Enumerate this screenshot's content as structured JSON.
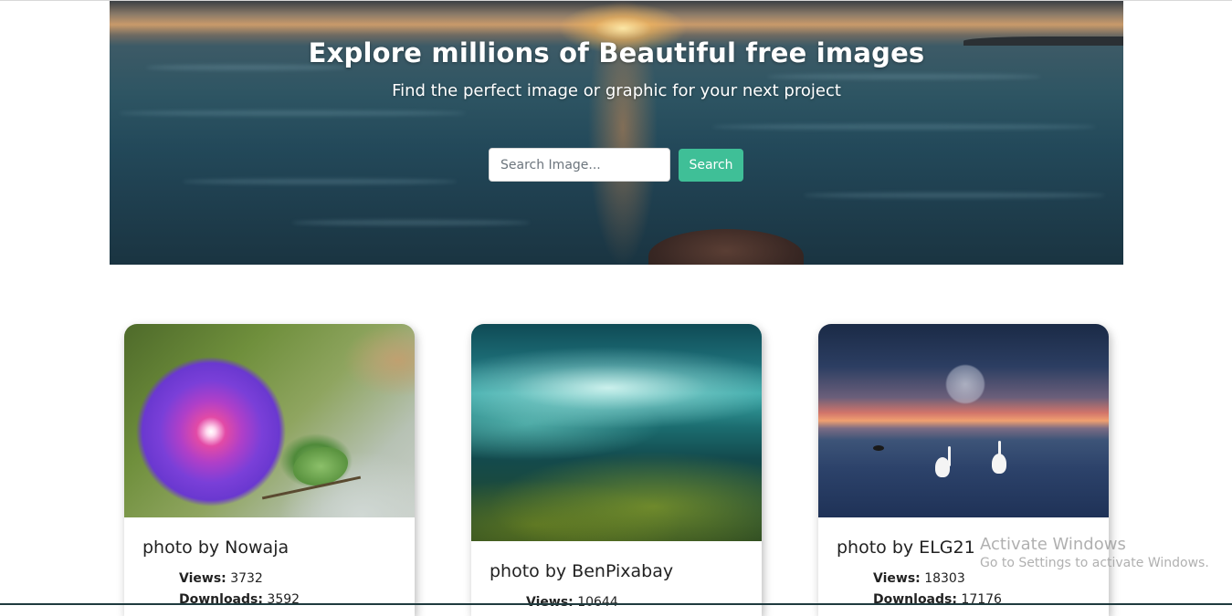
{
  "hero": {
    "title": "Explore millions of Beautiful free images",
    "subtitle": "Find the perfect image or graphic for your next project"
  },
  "search": {
    "placeholder": "Search Image...",
    "value": "",
    "button_label": "Search",
    "button_color": "#3fbf97"
  },
  "cards": [
    {
      "image_subject": "purple morning glory flower",
      "title": "photo by Nowaja",
      "views_label": "Views:",
      "views": "3732",
      "downloads_label": "Downloads:",
      "downloads": "3592"
    },
    {
      "image_subject": "underwater seaweed and wave",
      "title": "photo by BenPixabay",
      "views_label": "Views:",
      "views": "10644"
    },
    {
      "image_subject": "swans on lake at sunset",
      "title": "photo by ELG21",
      "views_label": "Views:",
      "views": "18303",
      "downloads_label": "Downloads:",
      "downloads": "17176"
    }
  ],
  "watermark": {
    "title": "Activate Windows",
    "subtitle": "Go to Settings to activate Windows."
  }
}
